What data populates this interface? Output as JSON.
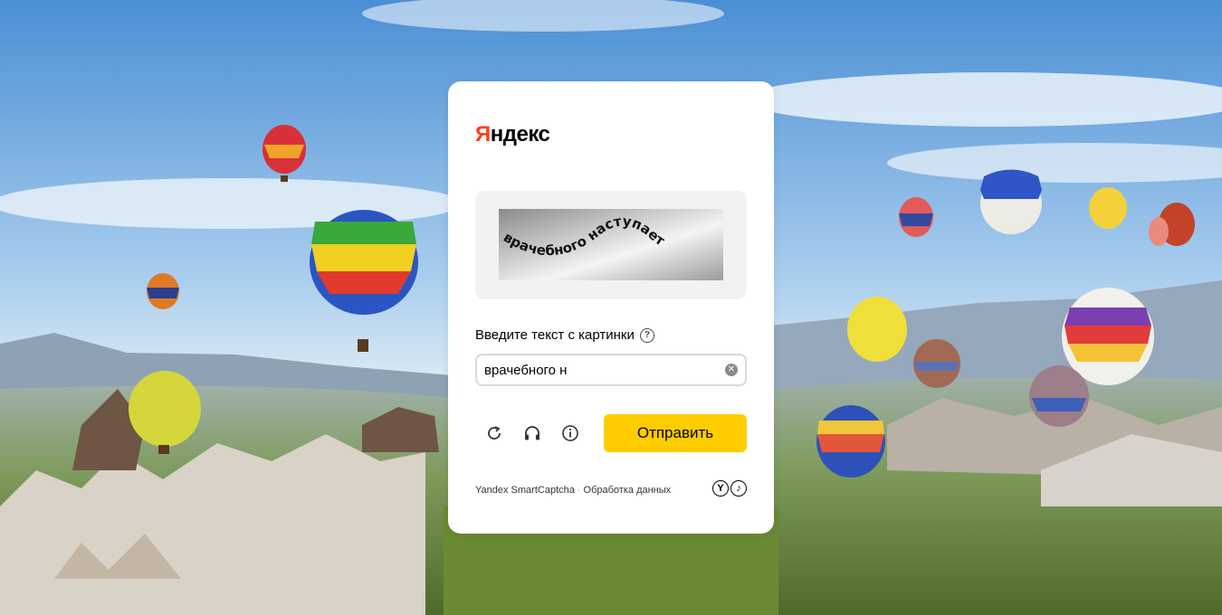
{
  "brand": {
    "logo_first": "Я",
    "logo_rest": "ндекс"
  },
  "captcha": {
    "image_text": "врачебного наступает",
    "prompt": "Введите текст с картинки",
    "input_value": "врачебного н",
    "submit_label": "Отправить"
  },
  "icons": {
    "help": "question-circle-icon",
    "clear": "clear-input-icon",
    "refresh": "refresh-icon",
    "audio": "headphones-icon",
    "info": "info-icon"
  },
  "footer": {
    "product": "Yandex SmartCaptcha",
    "separator": "·",
    "data_link": "Обработка данных",
    "badge_y": "Y",
    "badge_music": "♪"
  },
  "colors": {
    "brand_red": "#fc3f1d",
    "accent_yellow": "#ffcc00",
    "sky": "#7fb2e6"
  }
}
